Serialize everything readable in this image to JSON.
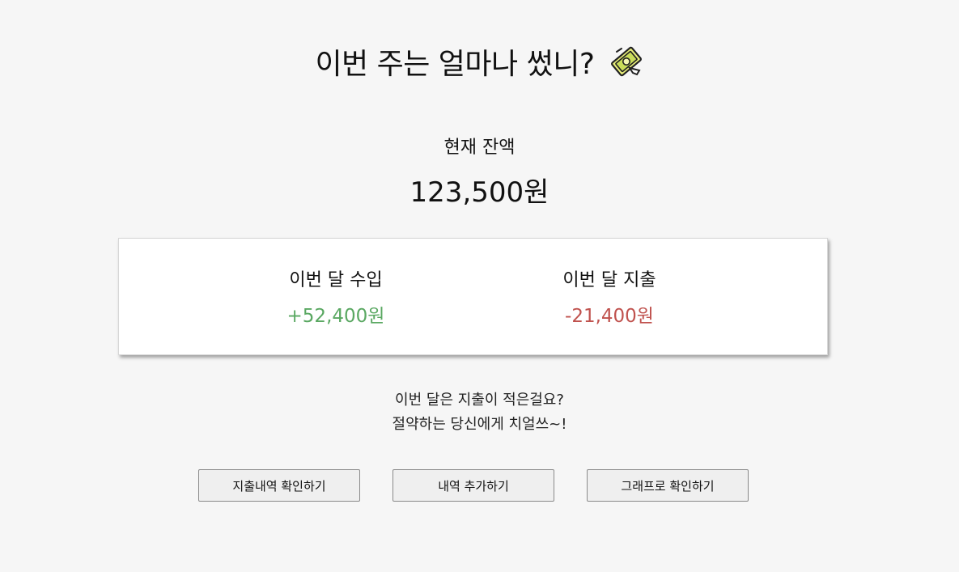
{
  "header": {
    "title": "이번 주는 얼마나 썼니?",
    "icon": "money-with-wings-icon"
  },
  "balance": {
    "label": "현재 잔액",
    "value": "123,500원"
  },
  "summary": {
    "income": {
      "label": "이번 달 수입",
      "value": "+52,400원",
      "color": "#5aa862"
    },
    "expense": {
      "label": "이번 달 지출",
      "value": "-21,400원",
      "color": "#c0524e"
    }
  },
  "message": {
    "line1": "이번 달은 지출이 적은걸요?",
    "line2": "절약하는 당신에게 치얼쓰~!"
  },
  "buttons": {
    "expense_history": "지출내역 확인하기",
    "add_entry": "내역 추가하기",
    "view_graph": "그래프로 확인하기"
  }
}
